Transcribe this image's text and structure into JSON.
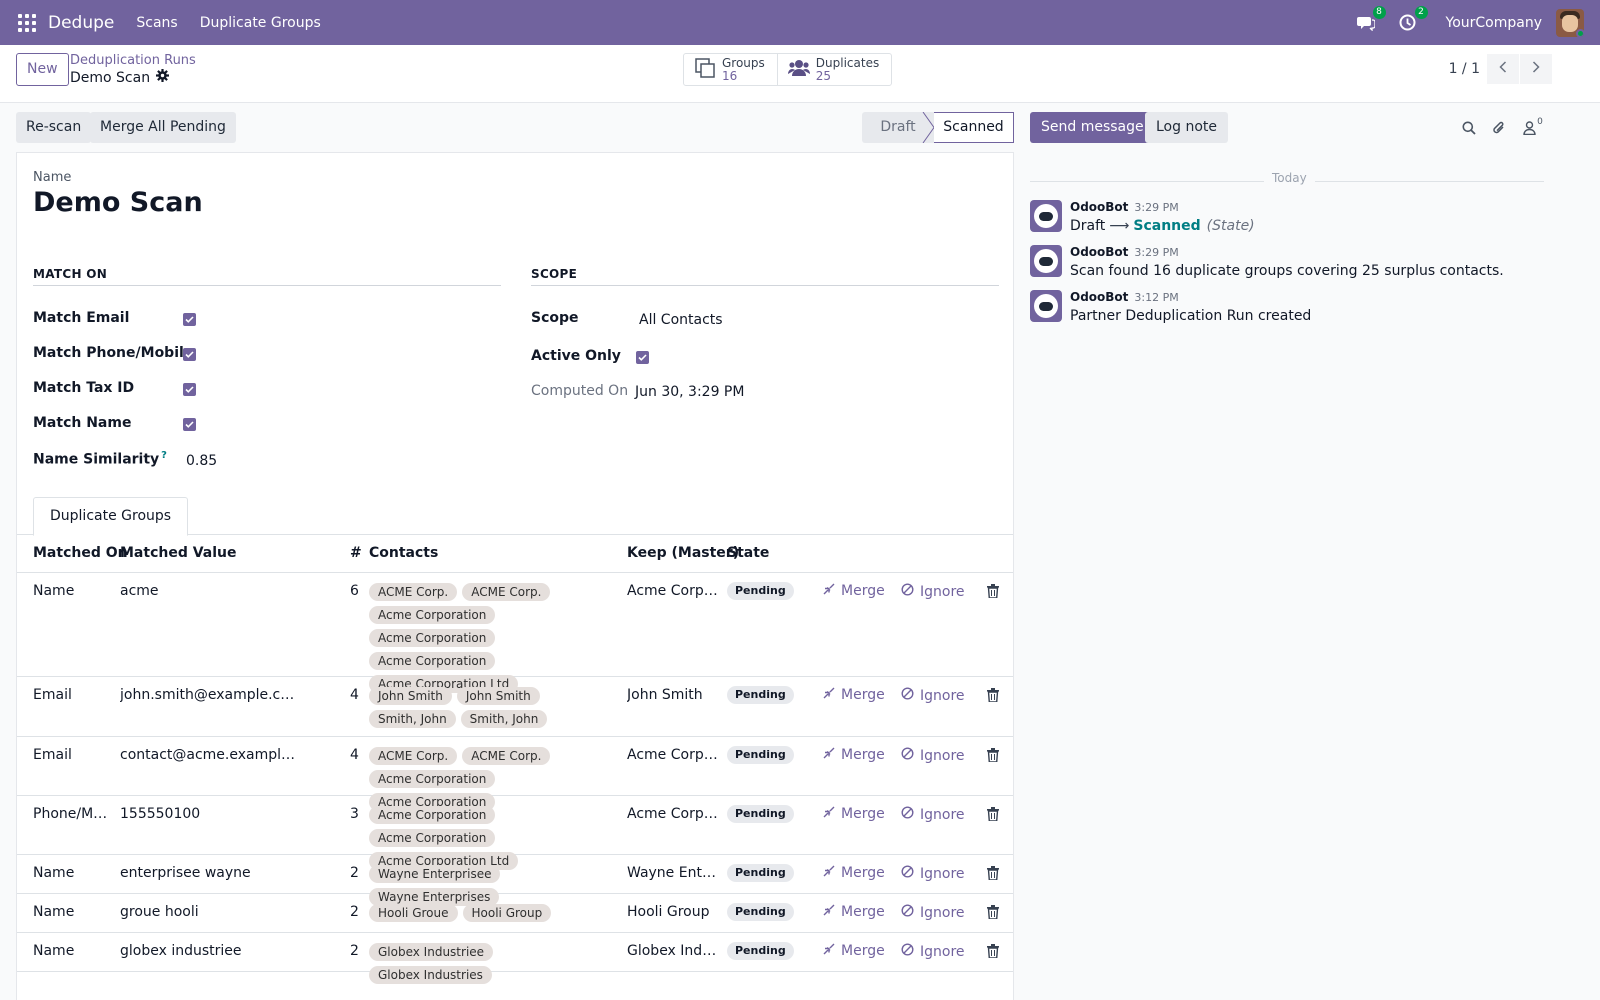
{
  "navbar": {
    "app_name": "Dedupe",
    "menus": [
      "Scans",
      "Duplicate Groups"
    ],
    "messages_count": "8",
    "activities_count": "2",
    "company": "YourCompany"
  },
  "control": {
    "new_label": "New",
    "breadcrumb_parent": "Deduplication Runs",
    "breadcrumb_current": "Demo Scan",
    "stats": [
      {
        "label": "Groups",
        "value": "16"
      },
      {
        "label": "Duplicates",
        "value": "25"
      }
    ],
    "pager": "1 / 1"
  },
  "statusbar": {
    "rescan_label": "Re-scan",
    "merge_all_label": "Merge All Pending",
    "stages": [
      "Draft",
      "Scanned"
    ],
    "current_stage": "Scanned"
  },
  "form": {
    "name_label": "Name",
    "name_value": "Demo Scan",
    "match_on_header": "MATCH ON",
    "scope_header": "SCOPE",
    "match_fields": [
      {
        "label": "Match Email",
        "checked": true
      },
      {
        "label": "Match Phone/Mobile",
        "checked": true
      },
      {
        "label": "Match Tax ID",
        "checked": true
      },
      {
        "label": "Match Name",
        "checked": true
      }
    ],
    "name_similarity_label": "Name Similarity",
    "name_similarity_tip": "?",
    "name_similarity_value": "0.85",
    "scope_label": "Scope",
    "scope_value": "All Contacts",
    "active_only_label": "Active Only",
    "active_only_checked": true,
    "computed_on_label": "Computed On",
    "computed_on_value": "Jun 30, 3:29 PM"
  },
  "tabs": [
    "Duplicate Groups"
  ],
  "table": {
    "columns": [
      "Matched On",
      "Matched Value",
      "#",
      "Contacts",
      "Keep (Master)",
      "State"
    ],
    "merge_label": "Merge",
    "ignore_label": "Ignore",
    "rows": [
      {
        "matched_on": "Name",
        "value": "acme",
        "count": "6",
        "contacts": [
          "ACME Corp.",
          "ACME Corp.",
          "Acme Corporation",
          "Acme Corporation",
          "Acme Corporation",
          "Acme Corporation Ltd"
        ],
        "master": "Acme Corpo…",
        "state": "Pending"
      },
      {
        "matched_on": "Email",
        "value": "john.smith@example.c…",
        "count": "4",
        "contacts": [
          "John Smith",
          "John Smith",
          "Smith, John",
          "Smith, John"
        ],
        "master": "John Smith",
        "state": "Pending"
      },
      {
        "matched_on": "Email",
        "value": "contact@acme.exampl…",
        "count": "4",
        "contacts": [
          "ACME Corp.",
          "ACME Corp.",
          "Acme Corporation",
          "Acme Corporation"
        ],
        "master": "Acme Corpo…",
        "state": "Pending"
      },
      {
        "matched_on": "Phone/M…",
        "value": "155550100",
        "count": "3",
        "contacts": [
          "Acme Corporation",
          "Acme Corporation",
          "Acme Corporation Ltd"
        ],
        "master": "Acme Corpo…",
        "state": "Pending"
      },
      {
        "matched_on": "Name",
        "value": "enterprisee wayne",
        "count": "2",
        "contacts": [
          "Wayne Enterprisee",
          "Wayne Enterprises"
        ],
        "master": "Wayne Ente…",
        "state": "Pending"
      },
      {
        "matched_on": "Name",
        "value": "groue hooli",
        "count": "2",
        "contacts": [
          "Hooli Groue",
          "Hooli Group"
        ],
        "master": "Hooli Group",
        "state": "Pending"
      },
      {
        "matched_on": "Name",
        "value": "globex industriee",
        "count": "2",
        "contacts": [
          "Globex Industriee",
          "Globex Industries"
        ],
        "master": "Globex Indu…",
        "state": "Pending"
      }
    ]
  },
  "chatter": {
    "send_message_label": "Send message",
    "log_note_label": "Log note",
    "followers_count": "0",
    "date_separator": "Today",
    "messages": [
      {
        "author": "OdooBot",
        "time": "3:29 PM",
        "old_state": "Draft",
        "new_state": "Scanned",
        "field": "(State)"
      },
      {
        "author": "OdooBot",
        "time": "3:29 PM",
        "body": "Scan found 16 duplicate groups covering 25 surplus contacts."
      },
      {
        "author": "OdooBot",
        "time": "3:12 PM",
        "body": "Partner Deduplication Run created"
      }
    ]
  },
  "colors": {
    "brand": "#71639e",
    "badge": "#00a04a",
    "state_highlight": "#017e84",
    "tag_bg": "#e5dfdc"
  }
}
